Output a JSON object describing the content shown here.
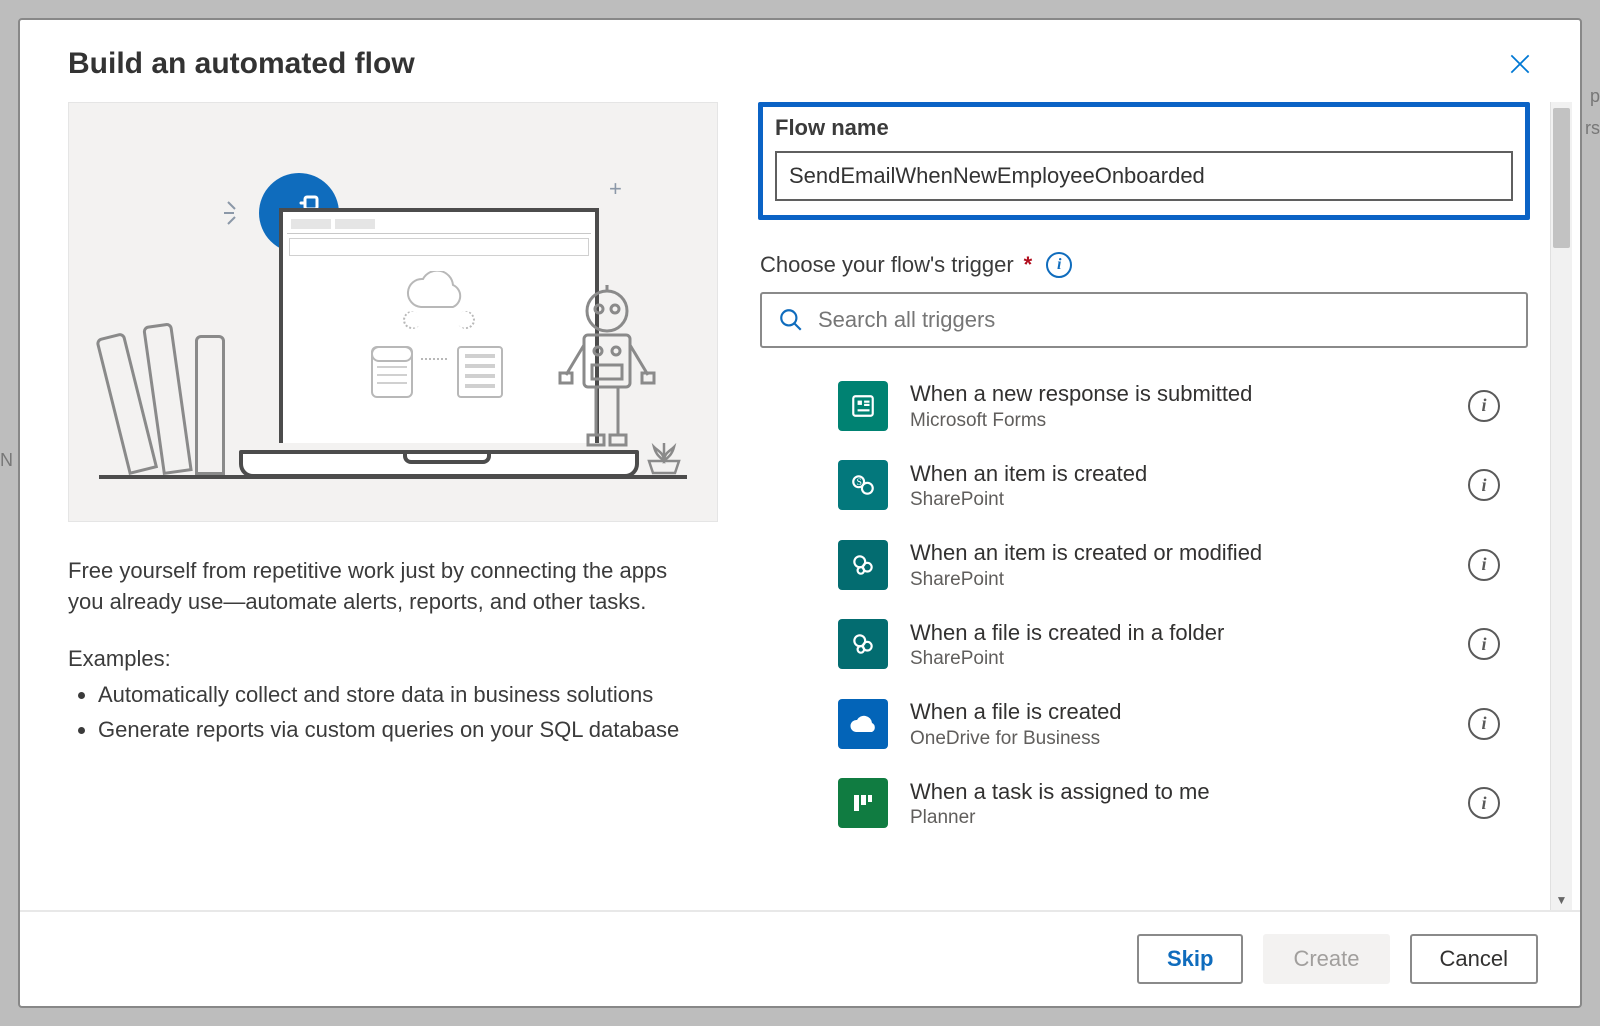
{
  "dialog": {
    "title": "Build an automated flow",
    "description": "Free yourself from repetitive work just by connecting the apps you already use—automate alerts, reports, and other tasks.",
    "examples_label": "Examples:",
    "examples": [
      "Automatically collect and store data in business solutions",
      "Generate reports via custom queries on your SQL database"
    ]
  },
  "form": {
    "flow_name_label": "Flow name",
    "flow_name_value": "SendEmailWhenNewEmployeeOnboarded",
    "trigger_label": "Choose your flow's trigger",
    "search_placeholder": "Search all triggers"
  },
  "triggers": [
    {
      "title": "When a new response is submitted",
      "subtitle": "Microsoft Forms",
      "icon": "forms"
    },
    {
      "title": "When an item is created",
      "subtitle": "SharePoint",
      "icon": "sharepoint"
    },
    {
      "title": "When an item is created or modified",
      "subtitle": "SharePoint",
      "icon": "sharepoint2"
    },
    {
      "title": "When a file is created in a folder",
      "subtitle": "SharePoint",
      "icon": "sharepoint2"
    },
    {
      "title": "When a file is created",
      "subtitle": "OneDrive for Business",
      "icon": "onedrive"
    },
    {
      "title": "When a task is assigned to me",
      "subtitle": "Planner",
      "icon": "planner"
    }
  ],
  "footer": {
    "skip": "Skip",
    "create": "Create",
    "cancel": "Cancel"
  },
  "icons": {
    "forms": "ic-forms",
    "sharepoint": "ic-sp",
    "sharepoint2": "ic-sp2",
    "onedrive": "ic-od",
    "planner": "ic-planner"
  }
}
